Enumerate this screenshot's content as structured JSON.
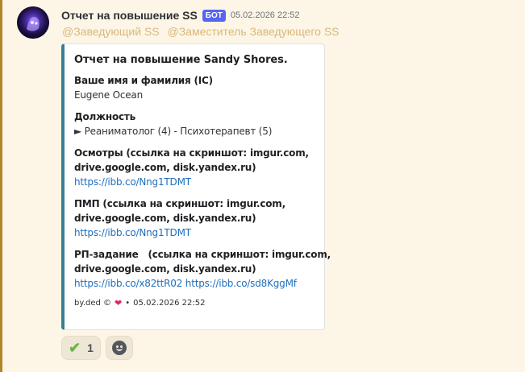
{
  "message": {
    "username": "Отчет на повышение SS",
    "badge": "БОТ",
    "timestamp": "05.02.2026 22:52",
    "mentions": [
      "@Заведующий SS",
      "@Заместитель Заведующего SS"
    ]
  },
  "embed": {
    "title": "Отчет на повышение Sandy Shores.",
    "accent_color": "#3a7e96",
    "fields": [
      {
        "name": "Ваше имя и фамилия (IC)",
        "value": [
          "Eugene Ocean"
        ],
        "is_link": false
      },
      {
        "name": "Должность",
        "value": [
          "► Реаниматолог (4) - Психотерапевт (5)"
        ],
        "is_link": false
      },
      {
        "name": [
          "Осмотры (ссылка на скриншот: imgur.com,",
          "drive.google.com, disk.yandex.ru)"
        ],
        "value": [
          "https://ibb.co/Nng1TDMT"
        ],
        "is_link": true
      },
      {
        "name": [
          "ПМП (ссылка на скриншот: imgur.com,",
          "drive.google.com, disk.yandex.ru)"
        ],
        "value": [
          "https://ibb.co/Nng1TDMT"
        ],
        "is_link": true
      },
      {
        "name": [
          "РП-задание   (ссылка на скриншот: imgur.com,",
          "drive.google.com, disk.yandex.ru)"
        ],
        "value": [
          "https://ibb.co/x82ttR02",
          "https://ibb.co/sd8KggMf"
        ],
        "is_link": true
      }
    ],
    "footer": {
      "text": "by.ded ©",
      "icon": "heart-icon",
      "separator": "•",
      "timestamp": "05.02.2026 22:52"
    }
  },
  "reactions": [
    {
      "icon": "check-icon",
      "count": "1"
    }
  ],
  "add_reaction_icon": "smiley-icon"
}
